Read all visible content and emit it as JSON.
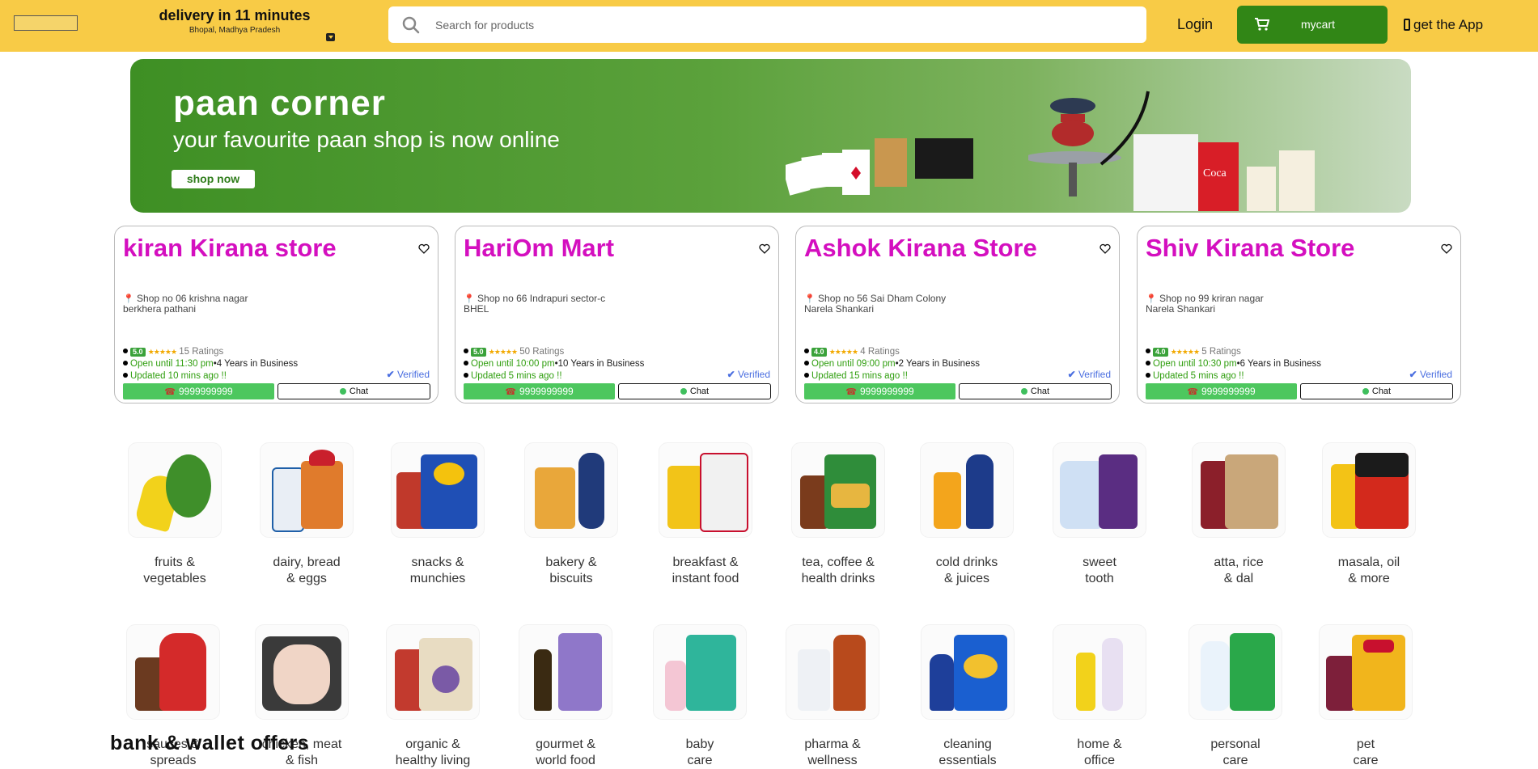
{
  "header": {
    "delivery_title": "delivery in 11 minutes",
    "location": "Bhopal, Madhya Pradesh",
    "search_placeholder": "Search for products",
    "login": "Login",
    "cart": "mycart",
    "get_app": "get the App"
  },
  "banner": {
    "title": "paan corner",
    "subtitle": "your favourite paan shop is now online",
    "button": "shop now"
  },
  "stores": [
    {
      "name": "kiran Kirana store",
      "addr1": "Shop no 06 krishna nagar",
      "addr2": "berkhera pathani",
      "rating": "5.0",
      "stars": "★★★★★",
      "ratings": "15 Ratings",
      "open": "Open until 11:30 pm",
      "years": "•4 Years in Business",
      "updated": "Updated 10 mins ago !!",
      "verified": "Verified",
      "phone": "9999999999",
      "chat": "Chat"
    },
    {
      "name": "HariOm Mart",
      "addr1": "Shop no 66 Indrapuri sector-c",
      "addr2": "BHEL",
      "rating": "5.0",
      "stars": "★★★★★",
      "ratings": "50 Ratings",
      "open": "Open until 10:00 pm",
      "years": "•10 Years in Business",
      "updated": "Updated 5 mins ago !!",
      "verified": "Verified",
      "phone": "9999999999",
      "chat": "Chat"
    },
    {
      "name": "Ashok Kirana Store",
      "addr1": "Shop no 56 Sai Dham Colony",
      "addr2": "Narela Shankari",
      "rating": "4.0",
      "stars": "★★★★★",
      "ratings": "4 Ratings",
      "open": "Open until 09:00 pm",
      "years": "•2 Years in Business",
      "updated": "Updated 15 mins ago !!",
      "verified": "Verified",
      "phone": "9999999999",
      "chat": "Chat"
    },
    {
      "name": "Shiv Kirana Store",
      "addr1": "Shop no 99 kriran nagar",
      "addr2": "Narela Shankari",
      "rating": "4.0",
      "stars": "★★★★★",
      "ratings": "5 Ratings",
      "open": "Open until 10:30 pm",
      "years": "•6 Years in Business",
      "updated": "Updated 5 mins ago !!",
      "verified": "Verified",
      "phone": "9999999999",
      "chat": "Chat"
    }
  ],
  "categories_row1": [
    {
      "l1": "fruits &",
      "l2": "vegetables"
    },
    {
      "l1": "dairy, bread",
      "l2": "& eggs"
    },
    {
      "l1": "snacks &",
      "l2": "munchies"
    },
    {
      "l1": "bakery &",
      "l2": "biscuits"
    },
    {
      "l1": "breakfast &",
      "l2": "instant food"
    },
    {
      "l1": "tea, coffee &",
      "l2": "health drinks"
    },
    {
      "l1": "cold drinks",
      "l2": "& juices"
    },
    {
      "l1": "sweet",
      "l2": "tooth"
    },
    {
      "l1": "atta, rice",
      "l2": "& dal"
    },
    {
      "l1": "masala, oil",
      "l2": "& more"
    }
  ],
  "categories_row2": [
    {
      "l1": "sauces &",
      "l2": "spreads"
    },
    {
      "l1": "chicken, meat",
      "l2": "& fish"
    },
    {
      "l1": "organic &",
      "l2": "healthy living"
    },
    {
      "l1": "gourmet &",
      "l2": "world food"
    },
    {
      "l1": "baby",
      "l2": "care"
    },
    {
      "l1": "pharma &",
      "l2": "wellness"
    },
    {
      "l1": "cleaning",
      "l2": "essentials"
    },
    {
      "l1": "home &",
      "l2": "office"
    },
    {
      "l1": "personal",
      "l2": "care"
    },
    {
      "l1": "pet",
      "l2": "care"
    }
  ],
  "offers_heading": "bank & wallet offers",
  "colors": {
    "header_bg": "#f8cb46",
    "cart_bg": "#318616",
    "store_name": "#d40fbf",
    "call_bg": "#4dc75e",
    "open_text": "#2f9e0e",
    "verified": "#4a6ee0"
  }
}
